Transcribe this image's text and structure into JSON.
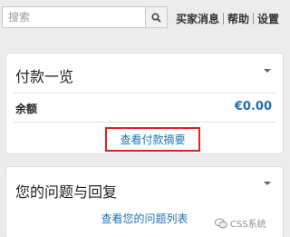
{
  "search": {
    "placeholder": "搜索",
    "icon": "search-icon"
  },
  "top_links": [
    {
      "label": "买家消息"
    },
    {
      "label": "帮助"
    },
    {
      "label": "设置"
    }
  ],
  "payment_card": {
    "title": "付款一览",
    "balance_label": "余额",
    "balance_value": "€0.00",
    "summary_link": "查看付款摘要"
  },
  "questions_card": {
    "title": "您的问题与回复",
    "list_link": "查看您的问题列表"
  },
  "watermark": {
    "text": "CSS系统"
  },
  "colors": {
    "link": "#1f6fb5",
    "highlight_border": "#e02020",
    "background": "#ececec"
  }
}
